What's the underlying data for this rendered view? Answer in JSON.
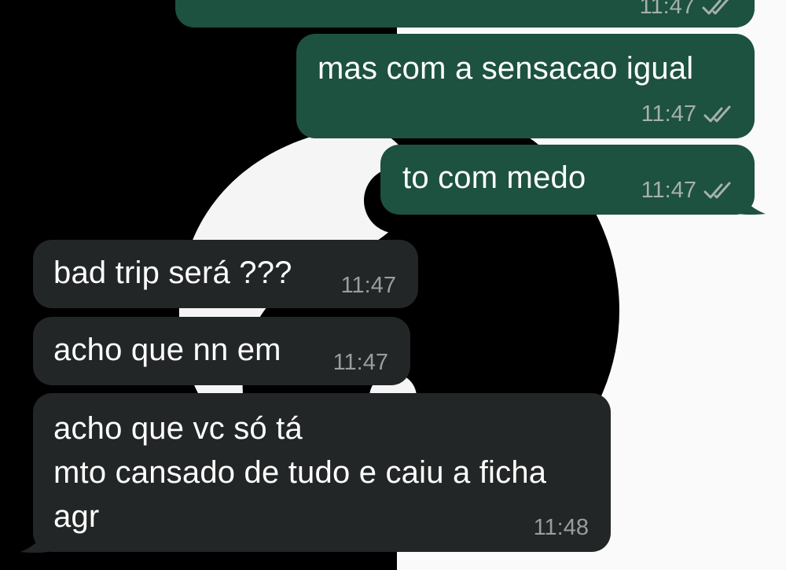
{
  "chat": {
    "theme": {
      "outgoing_bubble": "#1d5140",
      "incoming_bubble": "#232626",
      "wallpaper_dark": "#000000",
      "wallpaper_light": "#ffffff",
      "read_tick_color": "#a7b0ad"
    },
    "messages": [
      {
        "direction": "out",
        "text": "",
        "time": "11:47",
        "status_icon": "double-check-icon"
      },
      {
        "direction": "out",
        "text": "mas com a sensacao igual",
        "time": "11:47",
        "status_icon": "double-check-icon"
      },
      {
        "direction": "out",
        "text": "to com medo",
        "time": "11:47",
        "status_icon": "double-check-icon"
      },
      {
        "direction": "in",
        "text": "bad trip será ???",
        "time": "11:47"
      },
      {
        "direction": "in",
        "text": "acho que nn em",
        "time": "11:47"
      },
      {
        "direction": "in",
        "text": "acho que vc só tá\nmto cansado de tudo e caiu a ficha\nagr",
        "time": "11:48"
      }
    ]
  }
}
